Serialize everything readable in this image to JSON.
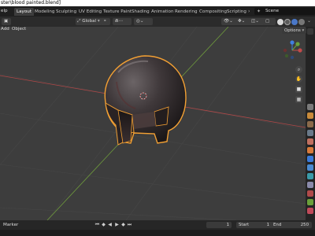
{
  "window": {
    "title": "ster\\blood painted.blend]"
  },
  "topbar": {
    "menu_fragment": "elp",
    "tabs": [
      "Layout",
      "Modeling",
      "Sculpting",
      "UV Editing",
      "Texture Paint",
      "Shading",
      "Animation",
      "Rendering",
      "Compositing",
      "Scripting"
    ],
    "active_tab": "Layout",
    "scene_label": "Scene"
  },
  "header": {
    "add_label": "Add",
    "object_label": "Object",
    "orientation_label": "Global",
    "options_label": "Options"
  },
  "timeline": {
    "marker_label": "Marker",
    "current_frame": "1",
    "start_label": "Start",
    "start_value": "1",
    "end_label": "End",
    "end_value": "250"
  },
  "colors": {
    "accent_orange": "#f3a033",
    "active_tab_bg": "#3d3d3d",
    "viewport_bg": "#3d3d3d",
    "axis_x_red": "#c24a4a",
    "axis_y_green": "#6aa03a",
    "axis_z_blue": "#3f7ee0"
  }
}
